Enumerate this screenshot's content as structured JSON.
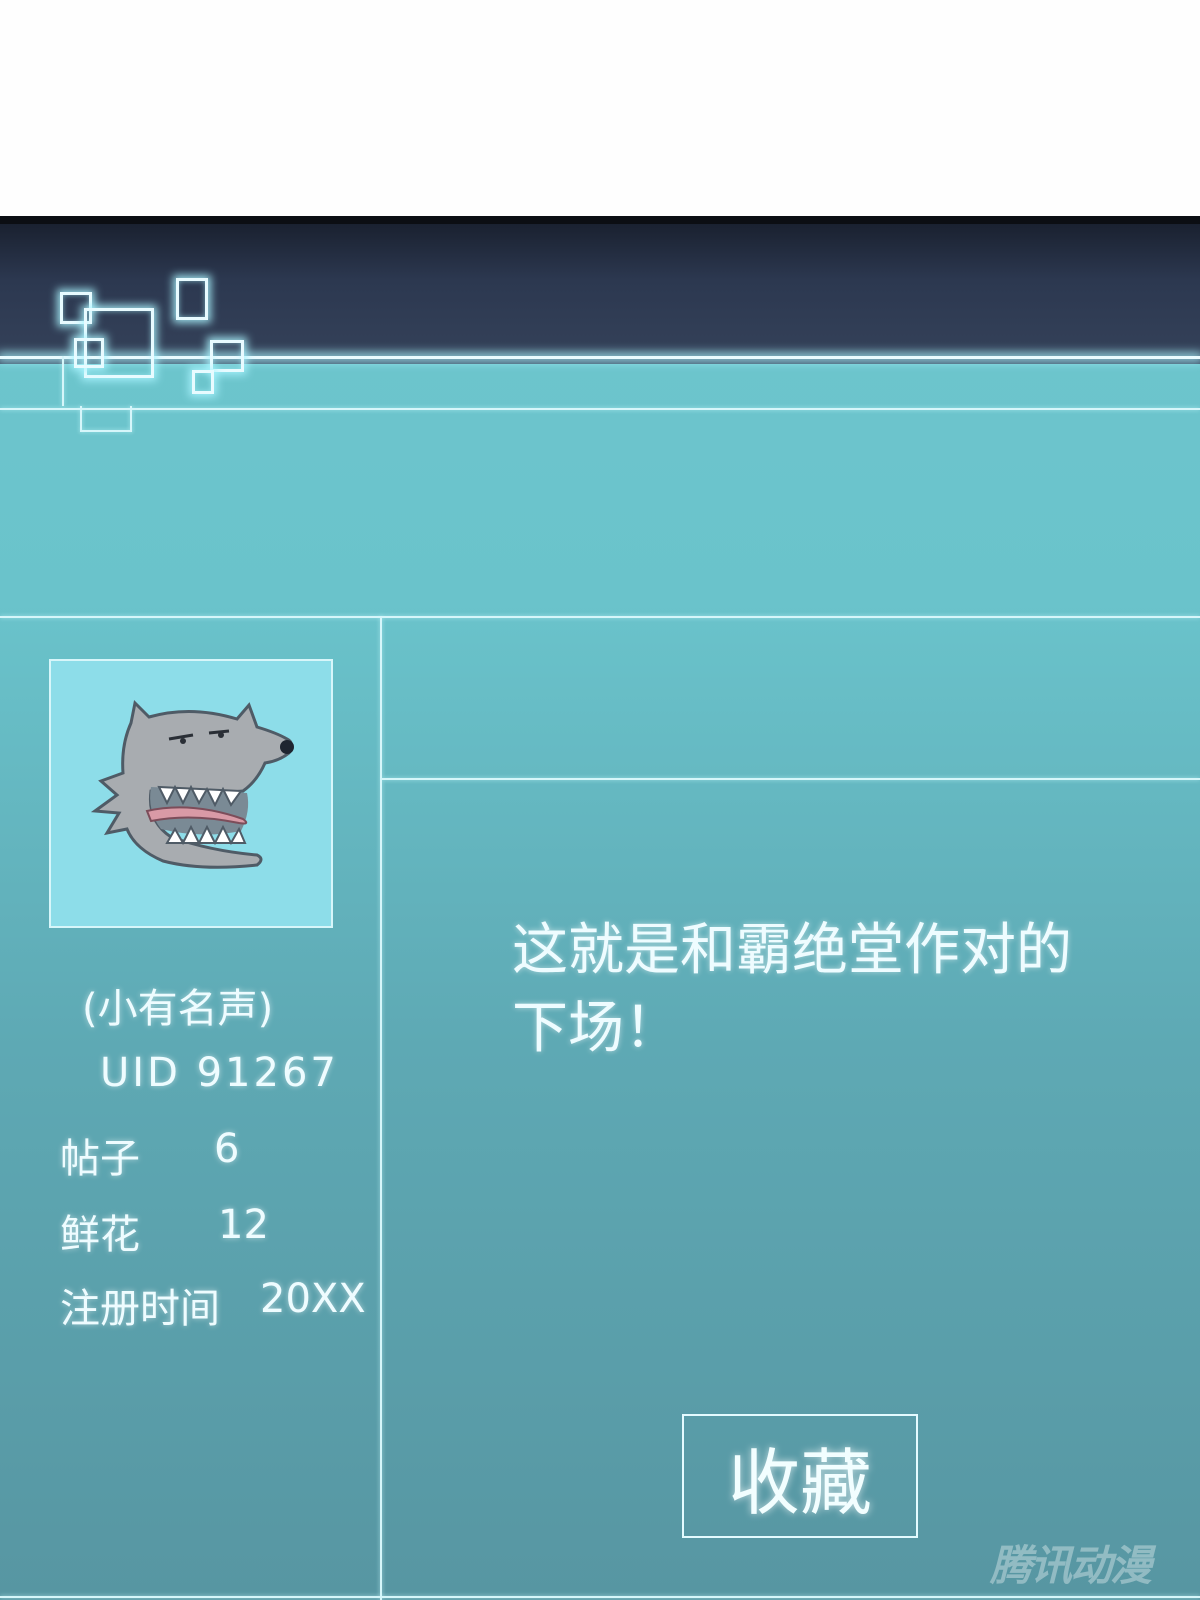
{
  "profile": {
    "rank": "(小有名声)",
    "uid": "UID 91267",
    "stats": [
      {
        "label": "帖子",
        "value": "6"
      },
      {
        "label": "鲜花",
        "value": "12"
      },
      {
        "label": "注册时间",
        "value": "20XX"
      }
    ]
  },
  "post": {
    "message": "这就是和霸绝堂作对的下场！"
  },
  "actions": {
    "favorite_label": "收藏"
  },
  "watermark": "腾讯动漫",
  "colors": {
    "panel": "#6ec6cd",
    "top_bar": "#2c3850",
    "glow": "#e9fbff",
    "avatar_bg": "#8ddde9"
  }
}
